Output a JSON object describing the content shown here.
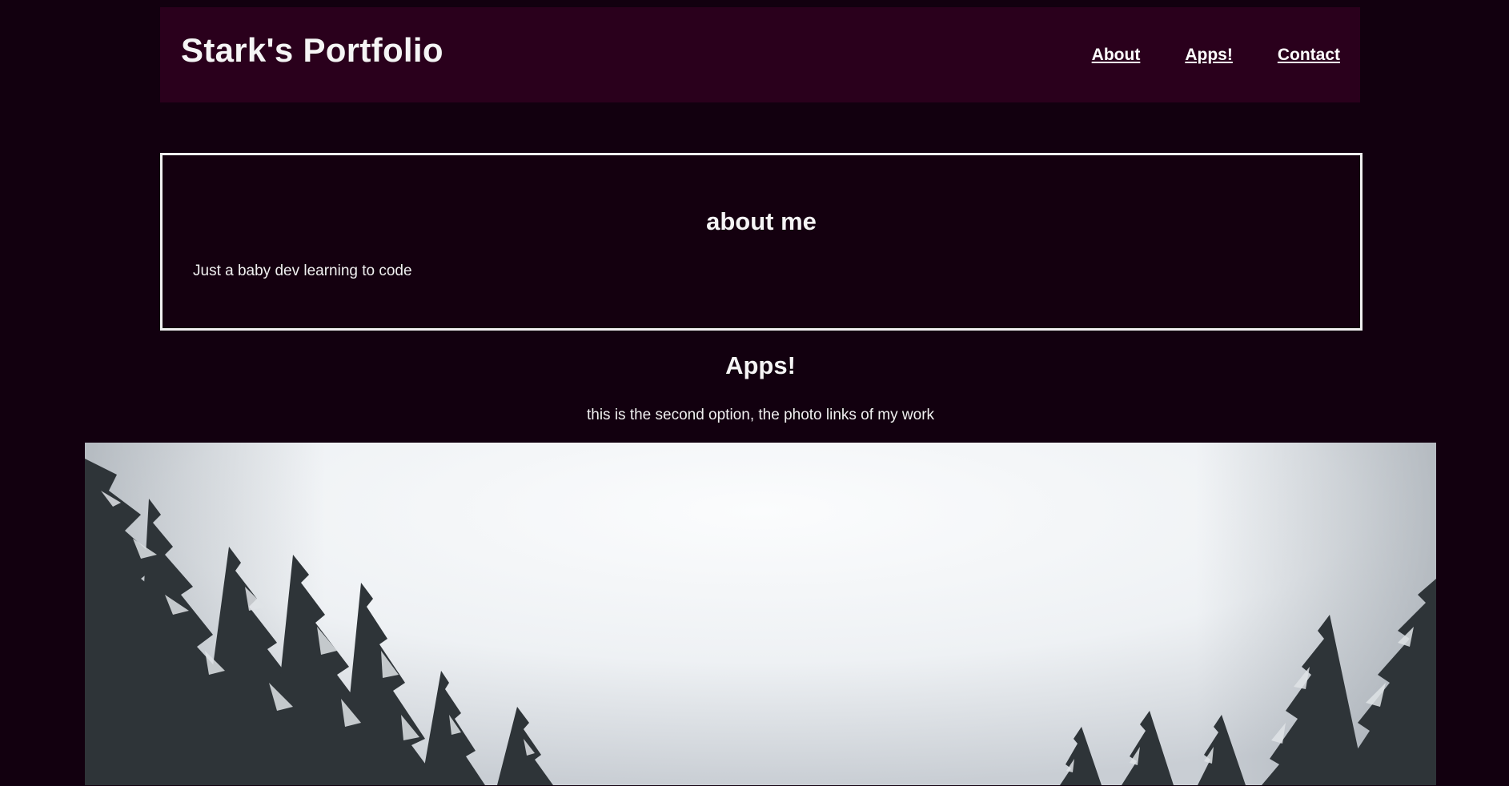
{
  "header": {
    "brand": "Stark's Portfolio",
    "nav": [
      {
        "label": "About"
      },
      {
        "label": "Apps!"
      },
      {
        "label": "Contact"
      }
    ]
  },
  "about": {
    "title": "about me",
    "text": "Just a baby dev learning to code"
  },
  "apps": {
    "title": "Apps!",
    "subtitle": "this is the second option, the photo links of my work"
  },
  "colors": {
    "background": "#12000f",
    "header_bg": "#2a001c",
    "text": "#f5f5f5",
    "border": "#efefef"
  },
  "photo": {
    "icon": "snowy-forest-photo"
  }
}
